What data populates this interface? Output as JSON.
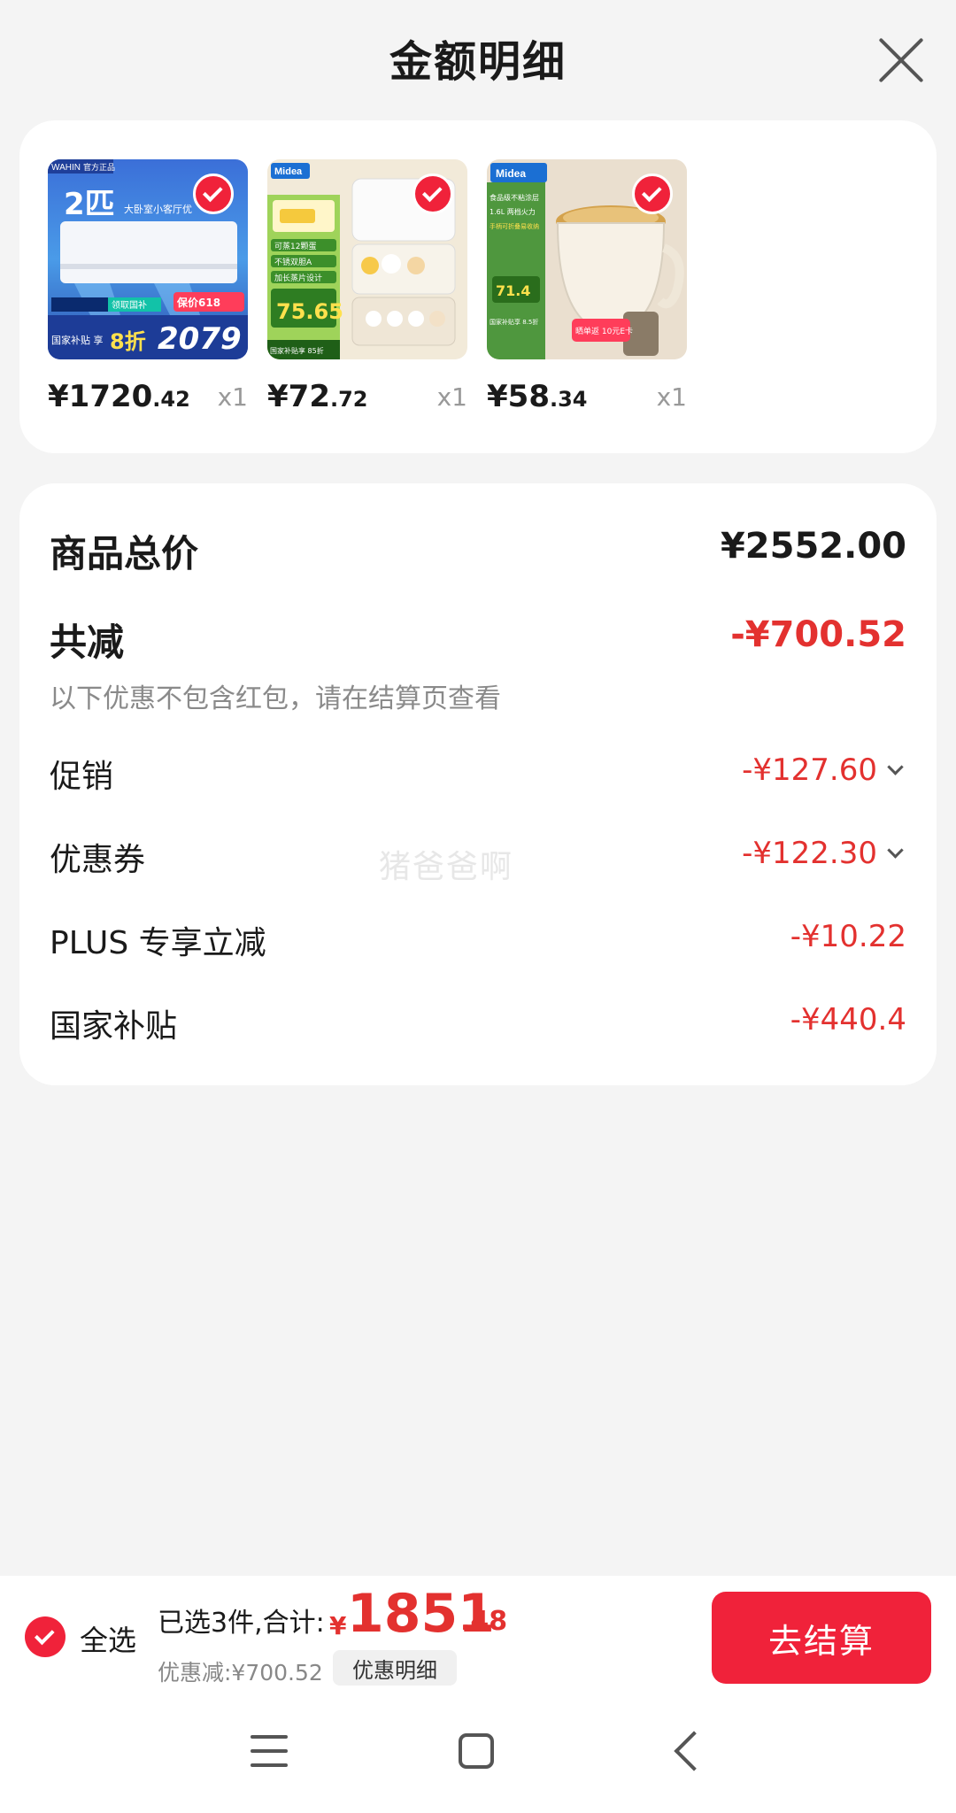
{
  "header": {
    "title": "金额明细"
  },
  "products": [
    {
      "name": "air-conditioner",
      "price_int": "¥1720",
      "price_dec": ".42",
      "qty": "x1",
      "image_text": {
        "brand": "WAHIN",
        "tag": "官方正品",
        "big": "2匹",
        "line": "大卧室小客厅优",
        "promo": "保价618",
        "strip": "领取国补",
        "discount": "8折",
        "price": "2079",
        "sub": "国家补贴 享"
      }
    },
    {
      "name": "egg-steamer",
      "price_int": "¥72",
      "price_dec": ".72",
      "qty": "x1",
      "image_text": {
        "brand": "Midea",
        "l1": "可蒸12颗蛋",
        "l2": "不锈双胆A",
        "l3": "加长蒸片设计",
        "price": "75.65",
        "sub": "国家补贴享 85折"
      }
    },
    {
      "name": "electric-pot",
      "price_int": "¥58",
      "price_dec": ".34",
      "qty": "x1",
      "image_text": {
        "brand": "Midea",
        "l1": "食品级不粘涂层",
        "l2": "1.6L 两档火力",
        "l3": "手柄可折叠易收纳",
        "price": "71.4",
        "sub": "国家补贴享 8.5折",
        "gift": "晒单返 10元E卡"
      }
    }
  ],
  "summary": {
    "total_label": "商品总价",
    "total_value": "¥2552.00",
    "reduce_label": "共减",
    "reduce_value": "-¥700.52",
    "note": "以下优惠不包含红包，请在结算页查看",
    "rows": [
      {
        "label": "促销",
        "value": "-¥127.60",
        "expandable": true
      },
      {
        "label": "优惠券",
        "value": "-¥122.30",
        "expandable": true
      },
      {
        "label": "PLUS 专享立减",
        "value": "-¥10.22",
        "expandable": false
      },
      {
        "label": "国家补贴",
        "value": "-¥440.4",
        "expandable": false
      }
    ],
    "watermark": "猪爸爸啊"
  },
  "bottom": {
    "select_all": "全选",
    "selected_text": "已选3件,合计:",
    "currency": "¥",
    "total_int": "1851",
    "total_dec": ".48",
    "discount_text": "优惠减:¥700.52",
    "detail_btn": "优惠明细",
    "checkout_btn": "去结算"
  },
  "colors": {
    "accent_red": "#f0223a",
    "price_red": "#e3312f",
    "background": "#f4f4f4"
  },
  "icons": [
    "close-icon",
    "check-icon",
    "chevron-down-icon",
    "menu-icon",
    "home-icon",
    "back-icon"
  ]
}
